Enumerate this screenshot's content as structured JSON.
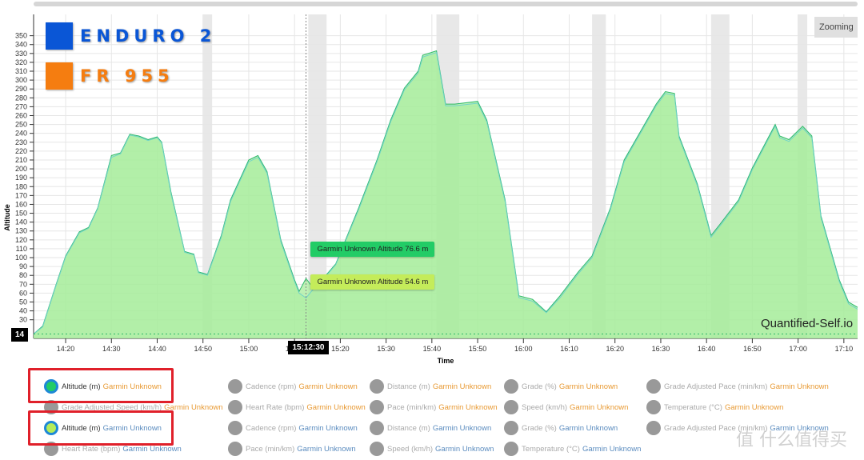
{
  "brands": [
    {
      "name": "ENDURO 2",
      "color": "#0a56d6"
    },
    {
      "name": "FR 955",
      "color": "#f57d10"
    }
  ],
  "zoom_button": "Zooming",
  "watermark": "Quantified-Self.io",
  "site_watermark": "值 什么值得买",
  "colors": {
    "area_fill": "#a8ec9c",
    "line_series1": "#2db86a",
    "line_series2": "#6fd3c8",
    "band": "#e8e8e8",
    "orange_source": "#e89a34",
    "blue_source": "#5b8cbf"
  },
  "chart_data": {
    "type": "area",
    "xlabel": "Time",
    "ylabel": "Altitude",
    "xlim": [
      "14:13",
      "17:13"
    ],
    "ylim": [
      9,
      374
    ],
    "x_ticks": [
      "14:20",
      "14:30",
      "14:40",
      "14:50",
      "15:00",
      "15:10",
      "15:20",
      "15:30",
      "15:40",
      "15:50",
      "16:00",
      "16:10",
      "16:20",
      "16:30",
      "16:40",
      "16:50",
      "17:00",
      "17:10"
    ],
    "y_ticks": [
      30,
      40,
      50,
      60,
      70,
      80,
      90,
      100,
      110,
      120,
      130,
      140,
      150,
      160,
      170,
      180,
      190,
      200,
      210,
      220,
      230,
      240,
      250,
      260,
      270,
      280,
      290,
      300,
      310,
      320,
      330,
      340,
      350
    ],
    "grid": true,
    "shaded_time_ranges": [
      [
        "14:50",
        "14:52"
      ],
      [
        "15:13",
        "15:17"
      ],
      [
        "15:41",
        "15:46"
      ],
      [
        "16:15",
        "16:18"
      ],
      [
        "16:41",
        "16:45"
      ],
      [
        "17:00",
        "17:02"
      ]
    ],
    "series": [
      {
        "name": "Garmin Unknown Altitude",
        "x": [
          "14:13",
          "14:15",
          "14:18",
          "14:20",
          "14:23",
          "14:25",
          "14:27",
          "14:30",
          "14:32",
          "14:34",
          "14:36",
          "14:38",
          "14:40",
          "14:41",
          "14:43",
          "14:46",
          "14:48",
          "14:49",
          "14:51",
          "14:54",
          "14:56",
          "15:00",
          "15:02",
          "15:04",
          "15:07",
          "15:10",
          "15:11",
          "15:12:30",
          "15:14",
          "15:16",
          "15:19",
          "15:24",
          "15:28",
          "15:31",
          "15:34",
          "15:37",
          "15:38",
          "15:41",
          "15:43",
          "15:45",
          "15:50",
          "15:52",
          "15:56",
          "15:59",
          "16:02",
          "16:05",
          "16:08",
          "16:12",
          "16:15",
          "16:19",
          "16:22",
          "16:26",
          "16:29",
          "16:31",
          "16:33",
          "16:34",
          "16:38",
          "16:41",
          "16:43",
          "16:47",
          "16:50",
          "16:55",
          "16:56",
          "16:58",
          "17:01",
          "17:03",
          "17:05",
          "17:09",
          "17:11",
          "17:13"
        ],
        "values": [
          14,
          23,
          71,
          102,
          129,
          134,
          156,
          215,
          218,
          239,
          237,
          233,
          236,
          230,
          174,
          107,
          104,
          84,
          81,
          125,
          165,
          210,
          215,
          197,
          120,
          75,
          62,
          76.6,
          66,
          75,
          93,
          156,
          210,
          255,
          291,
          310,
          328,
          333,
          273,
          273,
          276,
          255,
          165,
          57,
          53,
          39,
          57,
          84,
          102,
          156,
          210,
          246,
          273,
          287,
          285,
          237,
          183,
          125,
          138,
          165,
          201,
          250,
          237,
          233,
          248,
          237,
          147,
          75,
          50,
          44
        ]
      },
      {
        "name": "Garmin Unknown Altitude",
        "x": [
          "14:13",
          "14:15",
          "14:18",
          "14:20",
          "14:23",
          "14:25",
          "14:27",
          "14:30",
          "14:32",
          "14:34",
          "14:36",
          "14:38",
          "14:40",
          "14:41",
          "14:43",
          "14:46",
          "14:48",
          "14:49",
          "14:51",
          "14:54",
          "14:56",
          "15:00",
          "15:02",
          "15:04",
          "15:07",
          "15:10",
          "15:11",
          "15:12:30",
          "15:14",
          "15:16",
          "15:19",
          "15:24",
          "15:28",
          "15:31",
          "15:34",
          "15:37",
          "15:38",
          "15:41",
          "15:43",
          "15:45",
          "15:50",
          "15:52",
          "15:56",
          "15:59",
          "16:02",
          "16:05",
          "16:08",
          "16:12",
          "16:15",
          "16:19",
          "16:22",
          "16:26",
          "16:29",
          "16:31",
          "16:33",
          "16:34",
          "16:38",
          "16:41",
          "16:43",
          "16:47",
          "16:50",
          "16:55",
          "16:56",
          "16:58",
          "17:01",
          "17:03",
          "17:05",
          "17:09",
          "17:11",
          "17:13"
        ],
        "values": [
          14,
          22,
          70,
          101,
          128,
          133,
          155,
          213,
          217,
          238,
          236,
          232,
          235,
          229,
          172,
          106,
          103,
          83,
          80,
          123,
          163,
          208,
          213,
          195,
          118,
          73,
          60,
          54.6,
          64,
          74,
          92,
          154,
          208,
          253,
          289,
          308,
          326,
          331,
          271,
          271,
          274,
          253,
          163,
          55,
          51,
          38,
          55,
          82,
          100,
          154,
          208,
          244,
          271,
          285,
          283,
          235,
          181,
          123,
          136,
          163,
          199,
          248,
          235,
          231,
          246,
          235,
          145,
          73,
          48,
          42
        ]
      }
    ],
    "crosshair": {
      "x_label": "15:12:30",
      "y_label": "14"
    },
    "tooltips": [
      {
        "text": "Garmin Unknown Altitude 76.6 m",
        "color": "#22cc66"
      },
      {
        "text": "Garmin Unknown Altitude 54.6 m",
        "color": "#c4ec5a"
      }
    ]
  },
  "legend": [
    {
      "metric": "Altitude (m)",
      "source": "Garmin Unknown",
      "device": "orange",
      "on": true,
      "dot": "#22cc66"
    },
    {
      "metric": "Cadence (rpm)",
      "source": "Garmin Unknown",
      "device": "orange"
    },
    {
      "metric": "Distance (m)",
      "source": "Garmin Unknown",
      "device": "orange"
    },
    {
      "metric": "Grade (%)",
      "source": "Garmin Unknown",
      "device": "orange"
    },
    {
      "metric": "Grade Adjusted Pace (min/km)",
      "source": "Garmin Unknown",
      "device": "orange"
    },
    {
      "metric": "Grade Adjusted Speed (km/h)",
      "source": "Garmin Unknown",
      "device": "orange"
    },
    {
      "metric": "Heart Rate (bpm)",
      "source": "Garmin Unknown",
      "device": "orange"
    },
    {
      "metric": "Pace (min/km)",
      "source": "Garmin Unknown",
      "device": "orange"
    },
    {
      "metric": "Speed (km/h)",
      "source": "Garmin Unknown",
      "device": "orange"
    },
    {
      "metric": "Temperature (°C)",
      "source": "Garmin Unknown",
      "device": "orange"
    },
    {
      "metric": "Altitude (m)",
      "source": "Garmin Unknown",
      "device": "blue",
      "on": true,
      "dot": "#b4ec5a"
    },
    {
      "metric": "Cadence (rpm)",
      "source": "Garmin Unknown",
      "device": "blue"
    },
    {
      "metric": "Distance (m)",
      "source": "Garmin Unknown",
      "device": "blue"
    },
    {
      "metric": "Grade (%)",
      "source": "Garmin Unknown",
      "device": "blue"
    },
    {
      "metric": "Grade Adjusted Pace (min/km)",
      "source": "Garmin Unknown",
      "device": "blue"
    },
    {
      "metric": "Heart Rate (bpm)",
      "source": "Garmin Unknown",
      "device": "blue"
    },
    {
      "metric": "Pace (min/km)",
      "source": "Garmin Unknown",
      "device": "blue"
    },
    {
      "metric": "Speed (km/h)",
      "source": "Garmin Unknown",
      "device": "blue"
    },
    {
      "metric": "Temperature (°C)",
      "source": "Garmin Unknown",
      "device": "blue"
    }
  ]
}
